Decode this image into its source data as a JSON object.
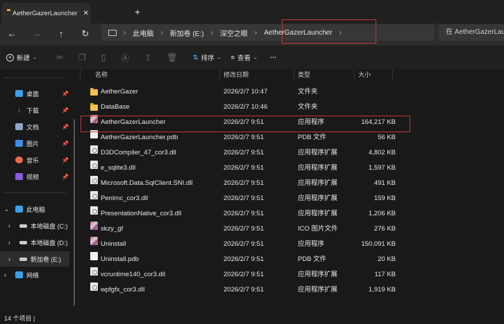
{
  "tab": {
    "title": "AetherGazerLauncher",
    "close": "✕",
    "new": "+"
  },
  "nav": {
    "back": "←",
    "forward": "→",
    "up": "↑",
    "refresh": "↻"
  },
  "breadcrumb": [
    "此电脑",
    "新加卷 (E:)",
    "深空之眼",
    "AetherGazerLauncher"
  ],
  "search_placeholder": "在 AetherGazerLauncher 中搜索",
  "toolbar": {
    "new": "新建",
    "sort": "排序",
    "view": "查看",
    "more": "···"
  },
  "columns": {
    "name": "名称",
    "date": "修改日期",
    "type": "类型",
    "size": "大小"
  },
  "sidebar": {
    "quick": [
      {
        "label": "桌面",
        "color": "#3aa0e8"
      },
      {
        "label": "下载",
        "color": "#2fb37c"
      },
      {
        "label": "文档",
        "color": "#8fa6c8"
      },
      {
        "label": "图片",
        "color": "#3a8ee8"
      },
      {
        "label": "音乐",
        "color": "#e86a4a"
      },
      {
        "label": "视频",
        "color": "#8a5ae0"
      }
    ],
    "pc": "此电脑",
    "drives": [
      "本地磁盘 (C:)",
      "本地磁盘 (D:)",
      "新加卷 (E:)"
    ],
    "network": "网络"
  },
  "files": [
    {
      "name": "AetherGazer",
      "date": "2026/2/7 10:47",
      "type": "文件夹",
      "size": "",
      "icon": "folder"
    },
    {
      "name": "DataBase",
      "date": "2026/2/7 10:46",
      "type": "文件夹",
      "size": "",
      "icon": "folder"
    },
    {
      "name": "AetherGazerLauncher",
      "date": "2026/2/7 9:51",
      "type": "应用程序",
      "size": "164,217 KB",
      "icon": "app"
    },
    {
      "name": "AetherGazerLauncher.pdb",
      "date": "2026/2/7 9:51",
      "type": "PDB 文件",
      "size": "56 KB",
      "icon": "doc"
    },
    {
      "name": "D3DCompiler_47_cor3.dll",
      "date": "2026/2/7 9:51",
      "type": "应用程序扩展",
      "size": "4,802 KB",
      "icon": "dll"
    },
    {
      "name": "e_sqlite3.dll",
      "date": "2026/2/7 9:51",
      "type": "应用程序扩展",
      "size": "1,597 KB",
      "icon": "dll"
    },
    {
      "name": "Microsoft.Data.SqlClient.SNI.dll",
      "date": "2026/2/7 9:51",
      "type": "应用程序扩展",
      "size": "491 KB",
      "icon": "dll"
    },
    {
      "name": "PenImc_cor3.dll",
      "date": "2026/2/7 9:51",
      "type": "应用程序扩展",
      "size": "159 KB",
      "icon": "dll"
    },
    {
      "name": "PresentationNative_cor3.dll",
      "date": "2026/2/7 9:51",
      "type": "应用程序扩展",
      "size": "1,206 KB",
      "icon": "dll"
    },
    {
      "name": "skzy_gf",
      "date": "2026/2/7 9:51",
      "type": "ICO 图片文件",
      "size": "276 KB",
      "icon": "app"
    },
    {
      "name": "Uninstall",
      "date": "2026/2/7 9:51",
      "type": "应用程序",
      "size": "150,091 KB",
      "icon": "app"
    },
    {
      "name": "Uninstall.pdb",
      "date": "2026/2/7 9:51",
      "type": "PDB 文件",
      "size": "20 KB",
      "icon": "doc"
    },
    {
      "name": "vcruntime140_cor3.dll",
      "date": "2026/2/7 9:51",
      "type": "应用程序扩展",
      "size": "117 KB",
      "icon": "dll"
    },
    {
      "name": "wpfgfx_cor3.dll",
      "date": "2026/2/7 9:51",
      "type": "应用程序扩展",
      "size": "1,919 KB",
      "icon": "dll"
    }
  ],
  "status": "14 个项目  |"
}
